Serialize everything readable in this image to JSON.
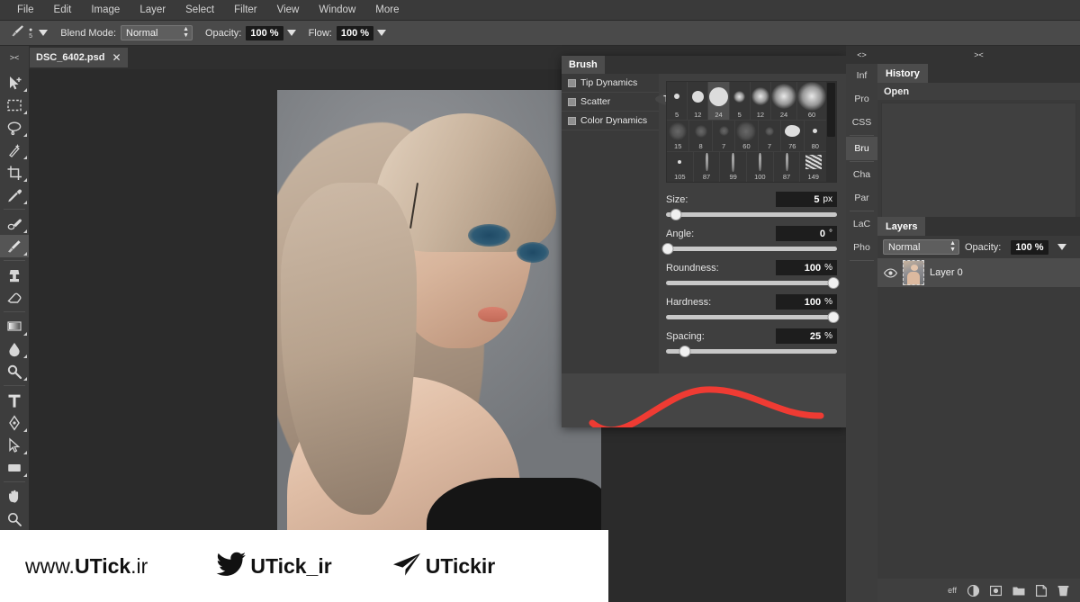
{
  "menubar": {
    "items": [
      "File",
      "Edit",
      "Image",
      "Layer",
      "Select",
      "Filter",
      "View",
      "Window",
      "More"
    ]
  },
  "optionsbar": {
    "tool_icon": "brush-icon",
    "brush_size_stepper": "5",
    "blend_mode_label": "Blend Mode:",
    "blend_mode_value": "Normal",
    "opacity_label": "Opacity:",
    "opacity_value": "100 %",
    "flow_label": "Flow:",
    "flow_value": "100 %"
  },
  "tabbar": {
    "collapse_glyph": "><",
    "document_name": "DSC_6402.psd",
    "close_glyph": "✕"
  },
  "toolbar": {
    "collapse_glyph": "><",
    "tools": [
      {
        "name": "move-tool",
        "selected": false,
        "corner": true
      },
      {
        "name": "marquee-select-tool",
        "selected": false,
        "corner": true
      },
      {
        "name": "lasso-tool",
        "selected": false,
        "corner": true
      },
      {
        "name": "magic-wand-tool",
        "selected": false,
        "corner": true
      },
      {
        "name": "crop-tool",
        "selected": false,
        "corner": true
      },
      {
        "name": "eyedropper-tool",
        "selected": false,
        "corner": true
      },
      {
        "name": "healing-brush-tool",
        "selected": false,
        "corner": true
      },
      {
        "name": "brush-tool",
        "selected": true,
        "corner": true
      },
      {
        "name": "clone-stamp-tool",
        "selected": false,
        "corner": false
      },
      {
        "name": "eraser-tool",
        "selected": false,
        "corner": false
      },
      {
        "name": "gradient-tool",
        "selected": false,
        "corner": true
      },
      {
        "name": "blur-tool",
        "selected": false,
        "corner": true
      },
      {
        "name": "dodge-tool",
        "selected": false,
        "corner": true
      },
      {
        "name": "type-tool",
        "selected": false,
        "corner": false
      },
      {
        "name": "pen-tool",
        "selected": false,
        "corner": true
      },
      {
        "name": "path-selection-tool",
        "selected": false,
        "corner": true
      },
      {
        "name": "shape-tool",
        "selected": false,
        "corner": true
      },
      {
        "name": "hand-tool",
        "selected": false,
        "corner": false
      },
      {
        "name": "zoom-tool",
        "selected": false,
        "corner": false
      }
    ]
  },
  "brush_panel": {
    "tab_label": "Brush",
    "sections": [
      {
        "label": "Tip Shape",
        "header": true,
        "checkbox": false
      },
      {
        "label": "Tip Dynamics",
        "header": false,
        "checkbox": true
      },
      {
        "label": "Scatter",
        "header": false,
        "checkbox": true
      },
      {
        "label": "Color Dynamics",
        "header": false,
        "checkbox": true
      }
    ],
    "presets": [
      [
        {
          "num": "5",
          "kind": "hard",
          "size": 6,
          "selected": false
        },
        {
          "num": "12",
          "kind": "hard",
          "size": 13,
          "selected": false
        },
        {
          "num": "24",
          "kind": "hard",
          "size": 21,
          "selected": true
        },
        {
          "num": "5",
          "kind": "soft",
          "size": 5,
          "selected": false
        },
        {
          "num": "12",
          "kind": "soft",
          "size": 12,
          "selected": false
        },
        {
          "num": "24",
          "kind": "soft",
          "size": 20,
          "selected": false
        },
        {
          "num": "60",
          "kind": "soft",
          "size": 24,
          "selected": false
        }
      ],
      [
        {
          "num": "15",
          "kind": "faint",
          "size": 16,
          "selected": false
        },
        {
          "num": "8",
          "kind": "faint",
          "size": 10,
          "selected": false
        },
        {
          "num": "7",
          "kind": "faint",
          "size": 7,
          "selected": false
        },
        {
          "num": "60",
          "kind": "faint",
          "size": 18,
          "selected": false
        },
        {
          "num": "7",
          "kind": "faint",
          "size": 6,
          "selected": false
        },
        {
          "num": "76",
          "kind": "blob",
          "size": 17,
          "selected": false
        },
        {
          "num": "80",
          "kind": "hard",
          "size": 5,
          "selected": false
        }
      ],
      [
        {
          "num": "105",
          "kind": "hard",
          "size": 4,
          "selected": false
        },
        {
          "num": "87",
          "kind": "streak",
          "size": 20,
          "selected": false
        },
        {
          "num": "99",
          "kind": "streak",
          "size": 21,
          "selected": false
        },
        {
          "num": "100",
          "kind": "streak",
          "size": 20,
          "selected": false
        },
        {
          "num": "87",
          "kind": "streak",
          "size": 20,
          "selected": false
        },
        {
          "num": "149",
          "kind": "texture",
          "size": 18,
          "selected": false
        }
      ]
    ],
    "sliders": [
      {
        "label": "Size:",
        "value": "5",
        "unit": "px",
        "pct": 6
      },
      {
        "label": "Angle:",
        "value": "0",
        "unit": "°",
        "pct": 1
      },
      {
        "label": "Roundness:",
        "value": "100",
        "unit": "%",
        "pct": 98
      },
      {
        "label": "Hardness:",
        "value": "100",
        "unit": "%",
        "pct": 98
      },
      {
        "label": "Spacing:",
        "value": "25",
        "unit": "%",
        "pct": 11
      }
    ],
    "preview_stroke_color": "#ef3b33"
  },
  "right_dock": {
    "rail_collapse_glyph": "<>",
    "rail_tabs": [
      {
        "label": "Inf",
        "selected": false
      },
      {
        "label": "Pro",
        "selected": false
      },
      {
        "label": "CSS",
        "selected": false
      },
      {
        "label": "Bru",
        "selected": true
      },
      {
        "label": "Cha",
        "selected": false
      },
      {
        "label": "Par",
        "selected": false
      },
      {
        "label": "LaC",
        "selected": false
      },
      {
        "label": "Pho",
        "selected": false
      }
    ],
    "dock_collapse_glyph": "><",
    "history": {
      "tab_label": "History",
      "items": [
        "Open"
      ]
    },
    "layers": {
      "tab_label": "Layers",
      "blend_mode_value": "Normal",
      "opacity_label": "Opacity:",
      "opacity_value": "100 %",
      "rows": [
        {
          "name": "Layer 0",
          "visible": true
        }
      ],
      "footer_icons": [
        "fx-icon",
        "adjustment-layer-icon",
        "layer-mask-icon",
        "new-group-icon",
        "new-layer-icon",
        "delete-layer-icon"
      ],
      "fx_label": "eff"
    }
  },
  "brandbar": {
    "website": {
      "prefix": "www.",
      "bold": "UTick",
      "suffix": ".ir"
    },
    "twitter": {
      "icon": "twitter-bird-icon",
      "handle": "UTick_ir"
    },
    "telegram": {
      "icon": "telegram-plane-icon",
      "handle": "UTickir"
    }
  },
  "colors": {
    "accent_red": "#ef3b33",
    "panel_bg": "#3f3f3f",
    "chrome_bg": "#3a3a3a",
    "canvas_bg": "#2b2b2b"
  }
}
